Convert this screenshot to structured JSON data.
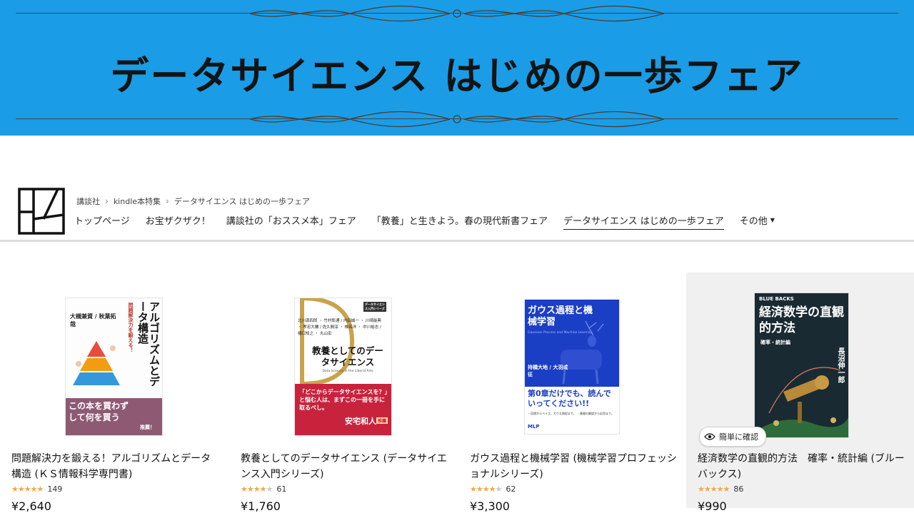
{
  "banner": {
    "title": "データサイエンス はじめの一歩フェア"
  },
  "breadcrumb": [
    "講談社",
    "kindle本特集",
    "データサイエンス はじめの一歩フェア"
  ],
  "nav": {
    "items": [
      "トップページ",
      "お宝ザクザク！",
      "講談社の「おススメ本」フェア",
      "「教養」と生きよう。春の現代新書フェア",
      "データサイエンス はじめの一歩フェア"
    ],
    "active_index": 4,
    "more": "その他"
  },
  "colors": {
    "banner": "#1a9de6",
    "star": "#f3a847"
  },
  "products": [
    {
      "title": "問題解決力を鍛える！アルゴリズムとデータ構造 (ＫＳ情報科学専門書)",
      "rating": 4.5,
      "count": "149",
      "price": "¥2,640",
      "cover": {
        "authors": "大槻兼資 / 秋葉拓哉",
        "heading": "アルゴリズムとデータ構造",
        "tagline": "問題解決力を鍛える！",
        "banner": "この本を買わずして何を買う",
        "recommend": "推薦！"
      }
    },
    {
      "title": "教養としてのデータサイエンス (データサイエンス入門シリーズ)",
      "rating": 4.0,
      "count": "61",
      "price": "¥1,760",
      "cover": {
        "series": "データサイエンス入門シリーズ",
        "authors": "北川源四郎 ・ 竹村彰通 / 内田誠一 ・ 川崎能典 ・ 孝忠大輔 / 佐久間淳 ・ 椎名洋 ・ 中川裕志 / 樋口知之 ・ 丸山宏",
        "heading": "教養としてのデータサイエンス",
        "subtitle": "Data Science in the Liberal Arts",
        "quote": "「どこからデータサイエンスを？」と悩む人は、まずこの一冊を手に取るべし。",
        "recommender": "安宅和人",
        "recommend": "推薦"
      }
    },
    {
      "title": "ガウス過程と機械学習 (機械学習プロフェッショナルシリーズ)",
      "rating": 4.0,
      "count": "62",
      "price": "¥3,300",
      "cover": {
        "heading": "ガウス過程と機械学習",
        "authors": "持橋大地 / 大羽成征",
        "subtitle": "Gaussian Process and Machine Learning",
        "catch": "第0章だけでも、読んでいってください!!",
        "bullets": "・回帰からベイズ、ガウス過程まで。 ・基礎の解説から応用まで。",
        "publisher": "MLP"
      }
    },
    {
      "title": "経済数学の直観的方法　確率・統計編 (ブルーバックス)",
      "rating": 4.5,
      "count": "86",
      "price": "¥990",
      "quick_label": "簡単に確認",
      "cover": {
        "series": "BLUE BACKS",
        "heading": "経済数学の直観的方法",
        "subtitle": "確率・統計編",
        "author": "長沼伸一郎"
      }
    }
  ]
}
